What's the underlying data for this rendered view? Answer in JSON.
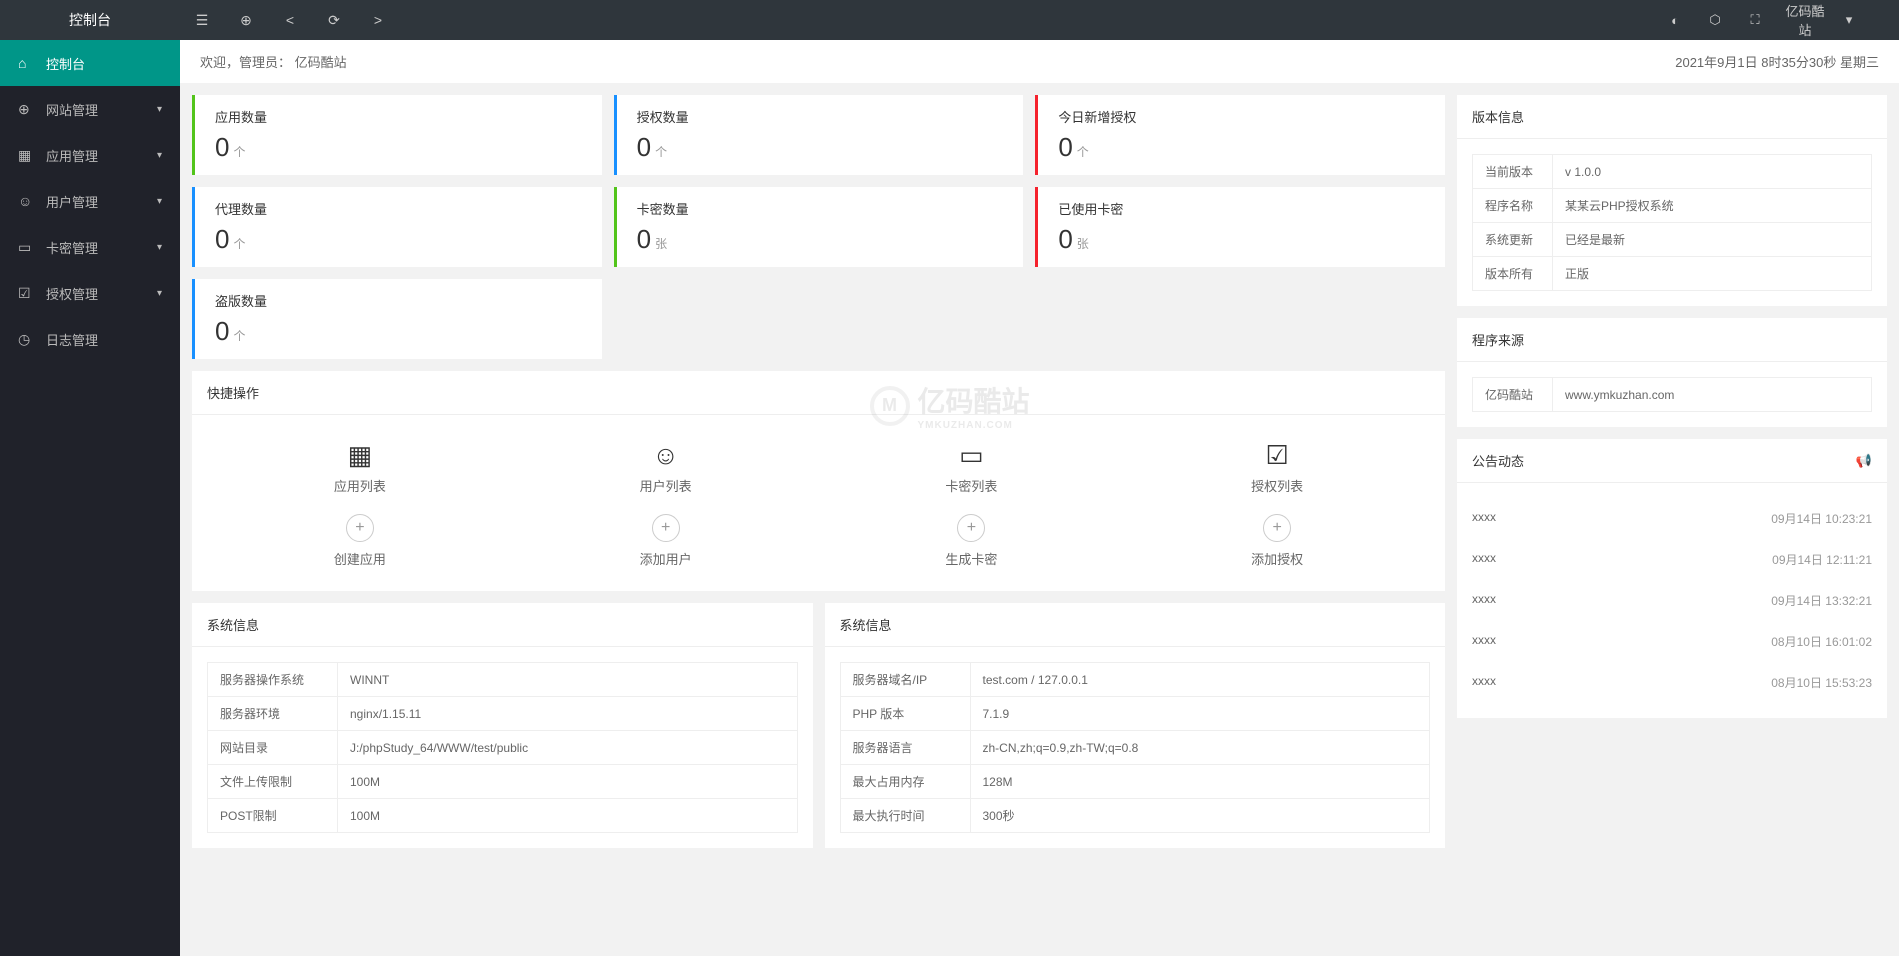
{
  "header": {
    "logo": "控制台",
    "user": "亿码酷站"
  },
  "welcome": {
    "prefix": "欢迎，管理员：",
    "name": "亿码酷站",
    "datetime": "2021年9月1日 8时35分30秒 星期三"
  },
  "sidebar": [
    {
      "label": "控制台",
      "icon": "⌂",
      "active": true,
      "expand": false
    },
    {
      "label": "网站管理",
      "icon": "⊕",
      "active": false,
      "expand": true
    },
    {
      "label": "应用管理",
      "icon": "▦",
      "active": false,
      "expand": true
    },
    {
      "label": "用户管理",
      "icon": "☺",
      "active": false,
      "expand": true
    },
    {
      "label": "卡密管理",
      "icon": "▭",
      "active": false,
      "expand": true
    },
    {
      "label": "授权管理",
      "icon": "☑",
      "active": false,
      "expand": true
    },
    {
      "label": "日志管理",
      "icon": "◷",
      "active": false,
      "expand": false
    }
  ],
  "stats": [
    {
      "title": "应用数量",
      "value": "0",
      "unit": "个",
      "color": "b-green"
    },
    {
      "title": "授权数量",
      "value": "0",
      "unit": "个",
      "color": "b-blue"
    },
    {
      "title": "今日新增授权",
      "value": "0",
      "unit": "个",
      "color": "b-red"
    },
    {
      "title": "代理数量",
      "value": "0",
      "unit": "个",
      "color": "b-blue"
    },
    {
      "title": "卡密数量",
      "value": "0",
      "unit": "张",
      "color": "b-green"
    },
    {
      "title": "已使用卡密",
      "value": "0",
      "unit": "张",
      "color": "b-red"
    },
    {
      "title": "盗版数量",
      "value": "0",
      "unit": "个",
      "color": "b-blue"
    }
  ],
  "quickTitle": "快捷操作",
  "quick": [
    {
      "icon": "▦",
      "label": "应用列表"
    },
    {
      "icon": "☺",
      "label": "用户列表"
    },
    {
      "icon": "▭",
      "label": "卡密列表"
    },
    {
      "icon": "☑",
      "label": "授权列表"
    },
    {
      "icon": "+",
      "label": "创建应用",
      "plus": true
    },
    {
      "icon": "+",
      "label": "添加用户",
      "plus": true
    },
    {
      "icon": "+",
      "label": "生成卡密",
      "plus": true
    },
    {
      "icon": "+",
      "label": "添加授权",
      "plus": true
    }
  ],
  "sysTitle": "系统信息",
  "sys1": [
    [
      "服务器操作系统",
      "WINNT"
    ],
    [
      "服务器环境",
      "nginx/1.15.11"
    ],
    [
      "网站目录",
      "J:/phpStudy_64/WWW/test/public"
    ],
    [
      "文件上传限制",
      "100M"
    ],
    [
      "POST限制",
      "100M"
    ]
  ],
  "sys2": [
    [
      "服务器域名/IP",
      "test.com / 127.0.0.1"
    ],
    [
      "PHP 版本",
      "7.1.9"
    ],
    [
      "服务器语言",
      "zh-CN,zh;q=0.9,zh-TW;q=0.8"
    ],
    [
      "最大占用内存",
      "128M"
    ],
    [
      "最大执行时间",
      "300秒"
    ]
  ],
  "version": {
    "title": "版本信息",
    "rows": [
      [
        "当前版本",
        "v 1.0.0"
      ],
      [
        "程序名称",
        "某某云PHP授权系统"
      ],
      [
        "系统更新",
        "已经是最新"
      ],
      [
        "版本所有",
        "正版"
      ]
    ]
  },
  "source": {
    "title": "程序来源",
    "rows": [
      [
        "亿码酷站",
        "www.ymkuzhan.com"
      ]
    ]
  },
  "announce": {
    "title": "公告动态",
    "items": [
      {
        "text": "xxxx",
        "time": "09月14日 10:23:21"
      },
      {
        "text": "xxxx",
        "time": "09月14日 12:11:21"
      },
      {
        "text": "xxxx",
        "time": "09月14日 13:32:21"
      },
      {
        "text": "xxxx",
        "time": "08月10日 16:01:02"
      },
      {
        "text": "xxxx",
        "time": "08月10日 15:53:23"
      }
    ]
  },
  "watermark": {
    "main": "亿码酷站",
    "sub": "YMKUZHAN.COM"
  }
}
